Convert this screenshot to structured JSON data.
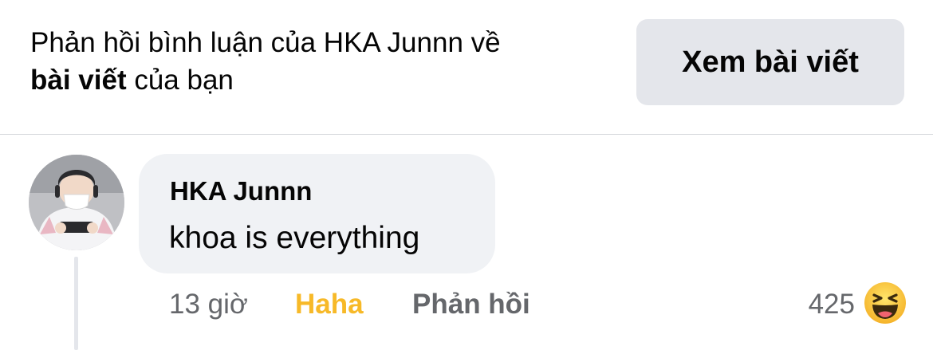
{
  "header": {
    "text_line1": "Phản hồi bình luận của HKA Junnn về",
    "text_bold": "bài viết",
    "text_rest": " của bạn",
    "view_post_label": "Xem bài viết"
  },
  "comment": {
    "author": "HKA Junnn",
    "text": "khoa is everything",
    "time": "13 giờ",
    "my_reaction": "Haha",
    "reply_label": "Phản hồi",
    "reaction_count": "425",
    "reaction_icon": "haha-emoji-icon"
  },
  "colors": {
    "button_bg": "#e4e6eb",
    "bubble_bg": "#f0f2f5",
    "meta_gray": "#65676b",
    "haha_yellow": "#f7b928"
  }
}
